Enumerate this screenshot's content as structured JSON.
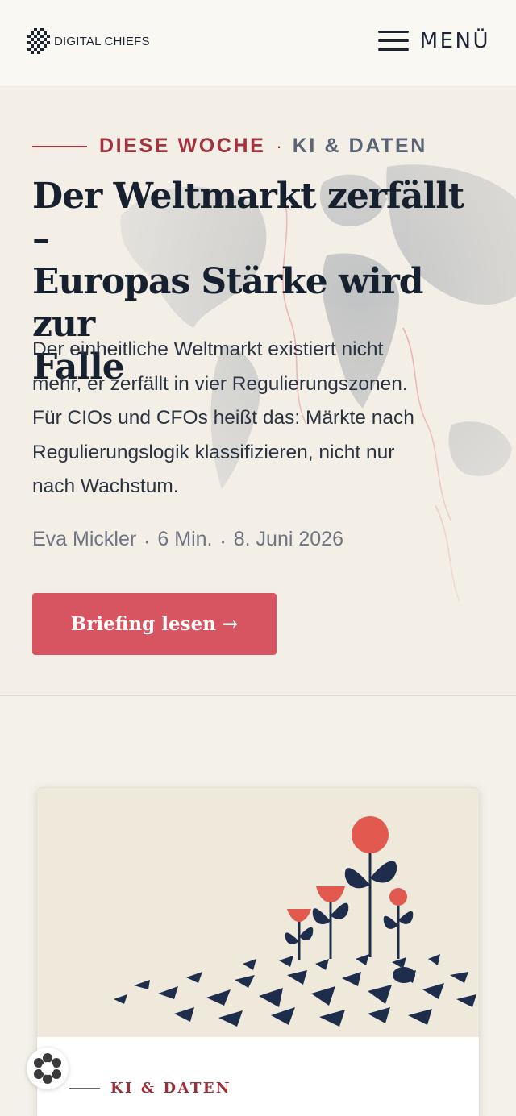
{
  "header": {
    "logo_text": "DIGITAL CHIEFS",
    "menu_label": "MENÜ"
  },
  "hero": {
    "kicker_section": "DIESE WOCHE",
    "kicker_separator": "·",
    "kicker_category": "KI & DATEN",
    "headline_lines": [
      "Der Weltmarkt zerfällt –",
      "Europas Stärke wird zur",
      "Falle"
    ],
    "teaser_lines": [
      "Der einheitliche Weltmarkt existiert nicht",
      "mehr, er zerfällt in vier Regulierungszonen.",
      "Für CIOs und CFOs heißt das: Märkte nach",
      "Regulierungslogik klassifizieren, nicht nur",
      "nach Wachstum."
    ],
    "author": "Eva Mickler",
    "read_time": "6 Min.",
    "date": "8. Juni 2026",
    "meta_separator": "●",
    "cta_label": "Briefing lesen →"
  },
  "card": {
    "category": "KI & DATEN"
  },
  "colors": {
    "accent_red": "#a3323d",
    "cta_red": "#d65560",
    "navy": "#17202f",
    "background": "#f4f1ea"
  },
  "icons": {
    "menu": "hamburger-icon",
    "logo": "checker-globe-icon",
    "float": "cookie-settings-icon"
  }
}
